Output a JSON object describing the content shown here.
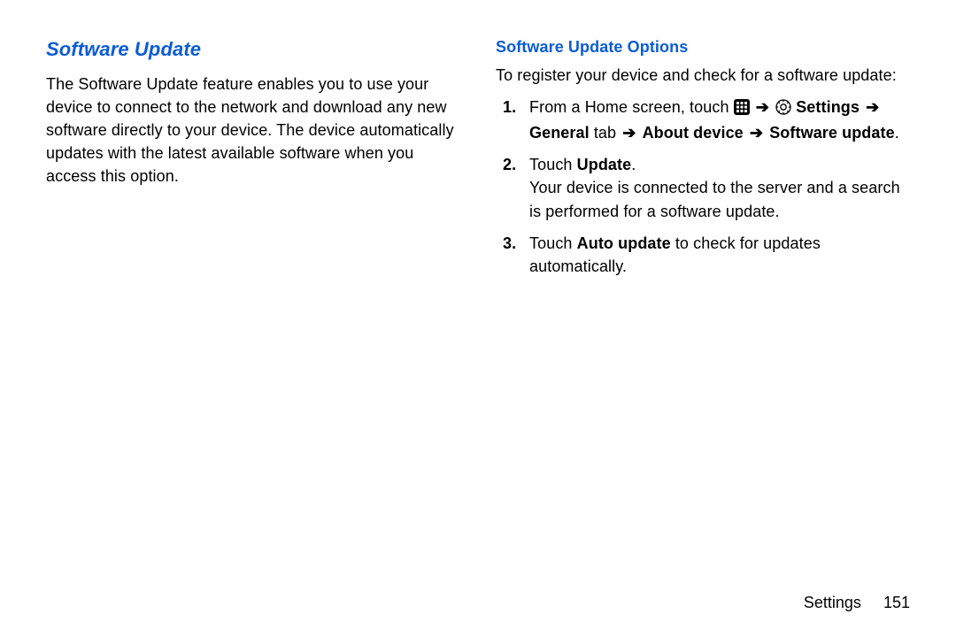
{
  "left": {
    "heading": "Software Update",
    "paragraph": "The Software Update feature enables you to use your device to connect to the network and download any new software directly to your device. The device automatically updates with the latest available software when you access this option."
  },
  "right": {
    "heading": "Software Update Options",
    "intro": "To register your device and check for a software update:",
    "steps": {
      "s1": {
        "num": "1.",
        "pre": "From a Home screen, touch ",
        "settings": " Settings",
        "general_tab": "General",
        "tab_word": " tab",
        "about_device": " About device",
        "software_update": " Software update",
        "period": "."
      },
      "s2": {
        "num": "2.",
        "touch": "Touch ",
        "update": "Update",
        "period": ".",
        "follow": "Your device is connected to the server and a search is performed for a software update."
      },
      "s3": {
        "num": "3.",
        "touch": "Touch ",
        "auto_update": "Auto update",
        "rest": " to check for updates automatically."
      }
    }
  },
  "arrow": "➔",
  "footer": {
    "section": "Settings",
    "page": "151"
  }
}
